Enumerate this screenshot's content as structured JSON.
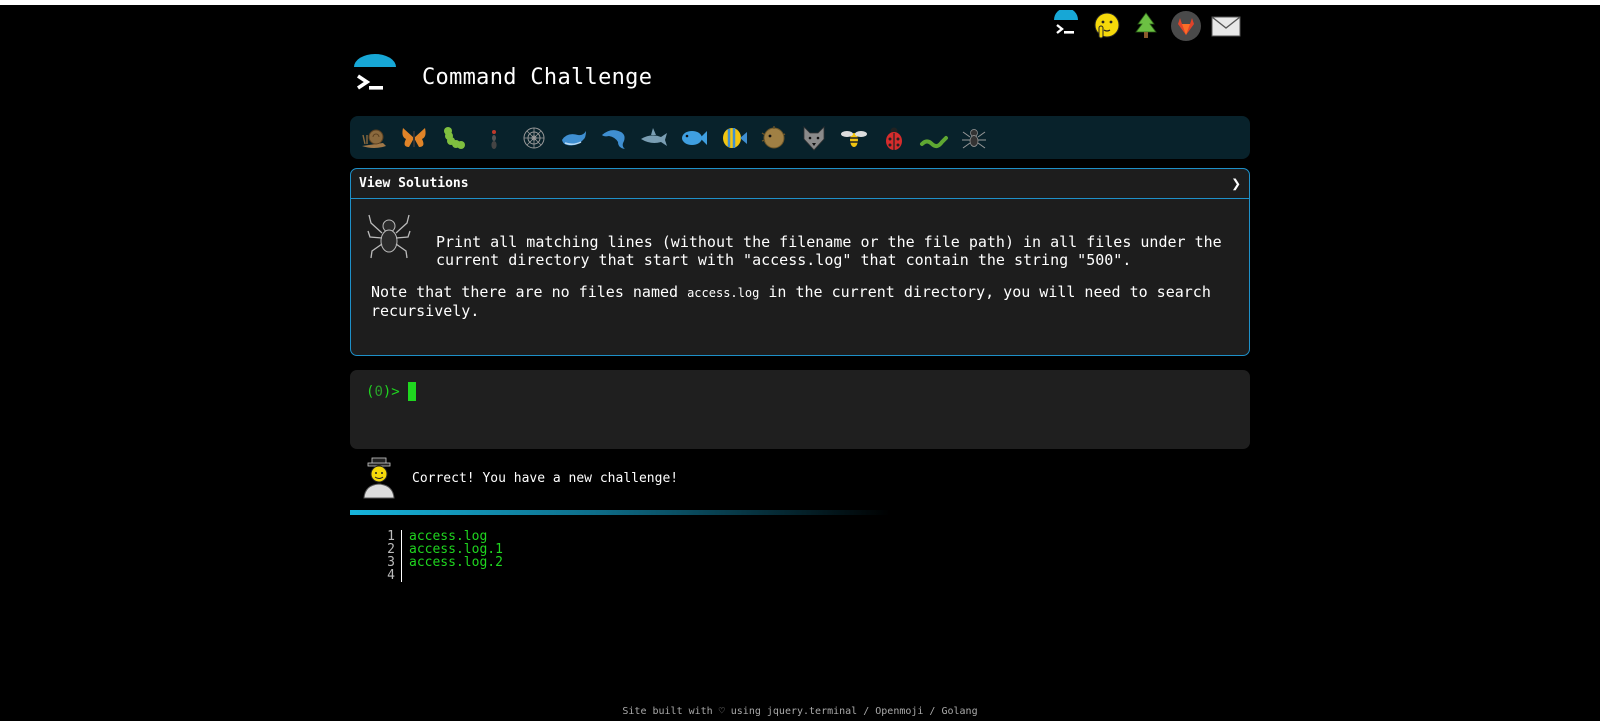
{
  "header": {
    "title": "Command Challenge"
  },
  "top_nav": [
    {
      "name": "terminal-icon"
    },
    {
      "name": "shushing-face-icon"
    },
    {
      "name": "tree-icon"
    },
    {
      "name": "gitlab-icon"
    },
    {
      "name": "envelope-icon"
    }
  ],
  "levels": [
    "snail-icon",
    "butterfly-icon",
    "caterpillar-icon",
    "ant-icon",
    "spider-web-icon",
    "whale-icon",
    "dolphin-icon",
    "shark-icon",
    "fish-icon",
    "tropical-fish-icon",
    "blowfish-icon",
    "wolf-icon",
    "bee-icon",
    "ladybug-icon",
    "worm-icon",
    "spider-icon"
  ],
  "panel": {
    "title": "View Solutions",
    "chevron": "❯",
    "description": "Print all matching lines (without the filename or the file path) in all files under the current directory that start with \"access.log\" that contain the string \"500\".",
    "note_prefix": "Note that there are no files named ",
    "note_code": "access.log",
    "note_suffix": " in the current directory, you will need to search recursively."
  },
  "terminal": {
    "prompt_open": "(",
    "prompt_num": "0",
    "prompt_close": ")>"
  },
  "message": {
    "text": "Correct! You have a new challenge!"
  },
  "output": {
    "lines": [
      {
        "num": "1",
        "text": "access.log"
      },
      {
        "num": "2",
        "text": "access.log.1"
      },
      {
        "num": "3",
        "text": "access.log.2"
      },
      {
        "num": "4",
        "text": ""
      }
    ]
  },
  "footer": {
    "text": "Site built with ♡ using jquery.terminal / Openmoji / Golang"
  },
  "colors": {
    "accent": "#1e90c8",
    "prompt": "#1fd61f",
    "bar": "#08222b"
  }
}
